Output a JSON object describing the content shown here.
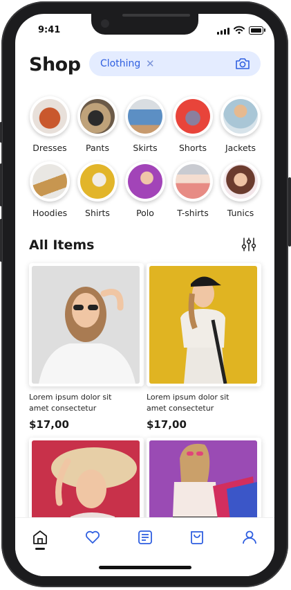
{
  "status": {
    "time": "9:41"
  },
  "header": {
    "title": "Shop"
  },
  "search": {
    "chip_label": "Clothing",
    "clear_icon": "close-icon",
    "camera_icon": "camera-icon"
  },
  "categories": [
    {
      "label": "Dresses",
      "photo": "handbag"
    },
    {
      "label": "Pants",
      "photo": "watch"
    },
    {
      "label": "Skirts",
      "photo": "man-denim"
    },
    {
      "label": "Shorts",
      "photo": "sneaker"
    },
    {
      "label": "Jackets",
      "photo": "woman-bra"
    },
    {
      "label": "Hoodies",
      "photo": "boot"
    },
    {
      "label": "Shirts",
      "photo": "woman-yellow"
    },
    {
      "label": "Polo",
      "photo": "woman-purple"
    },
    {
      "label": "T-shirts",
      "photo": "woman-pink-skirt"
    },
    {
      "label": "Tunics",
      "photo": "woman-smiling"
    }
  ],
  "items_section": {
    "title": "All Items",
    "filter_icon": "sliders-icon"
  },
  "products": [
    {
      "title_line1": "Lorem ipsum dolor sit",
      "title_line2": "amet consectetur",
      "price": "$17,00",
      "bg": "#dedede"
    },
    {
      "title_line1": "Lorem ipsum dolor sit",
      "title_line2": "amet consectetur",
      "price": "$17,00",
      "bg": "#e0b422"
    },
    {
      "bg": "#c8314a"
    },
    {
      "bg": "#9a4bb4"
    }
  ],
  "tabbar": {
    "active": "home",
    "items": [
      "home-icon",
      "heart-icon",
      "orders-icon",
      "bag-icon",
      "profile-icon"
    ]
  }
}
